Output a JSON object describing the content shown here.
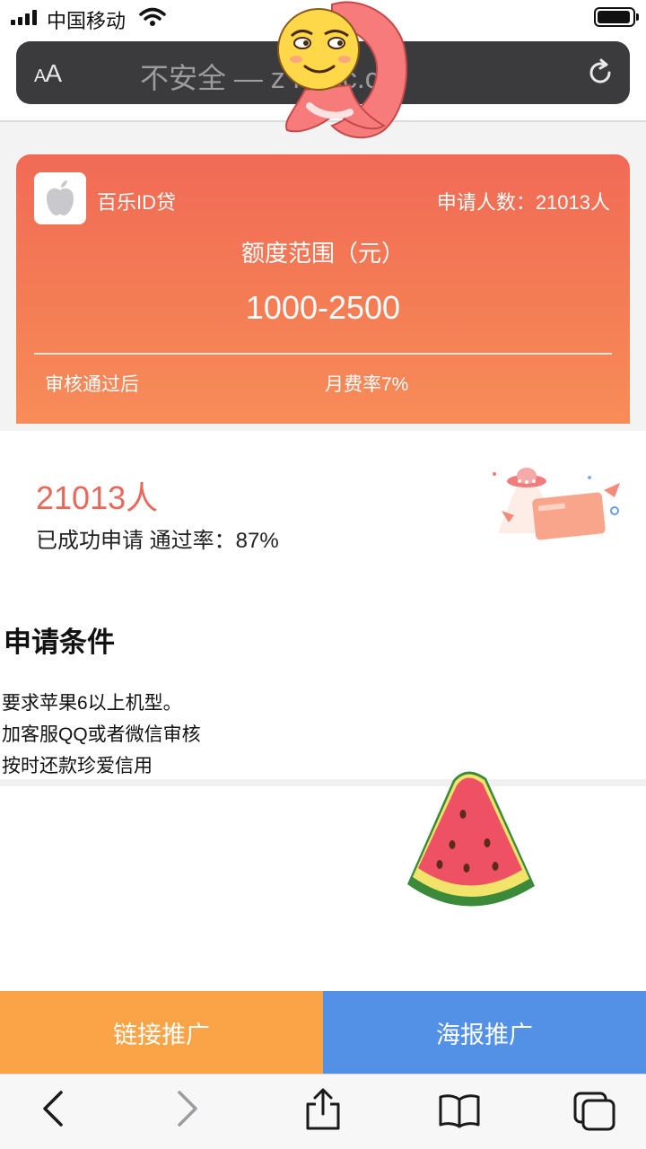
{
  "status_bar": {
    "carrier": "中国移动"
  },
  "url_bar": {
    "text_size_label_small": "A",
    "text_size_label_large": "A",
    "url_text": "不安全 — z                       n-tec.cn"
  },
  "card": {
    "app_name": "百乐ID贷",
    "applicant_count": "申请人数：21013人",
    "range_label": "额度范围（元）",
    "range_value": "1000-2500",
    "footer_left": "审核通过后",
    "footer_right": "月费率7%"
  },
  "stats": {
    "count": "21013人",
    "description": "已成功申请 通过率：87%"
  },
  "conditions": {
    "title": "申请条件",
    "lines": [
      "要求苹果6以上机型。",
      "加客服QQ或者微信审核",
      "按时还款珍爱信用"
    ]
  },
  "buttons": {
    "link_promo": "链接推广",
    "poster_promo": "海报推广"
  },
  "colors": {
    "card_gradient_top": "#f16a56",
    "card_gradient_bottom": "#f88c58",
    "stat_number": "#e8685a",
    "link_button": "#fba447",
    "poster_button": "#5291e5"
  },
  "icons": {
    "toolbar": [
      "back-icon",
      "forward-icon",
      "share-icon",
      "bookmarks-icon",
      "tabs-icon"
    ]
  }
}
